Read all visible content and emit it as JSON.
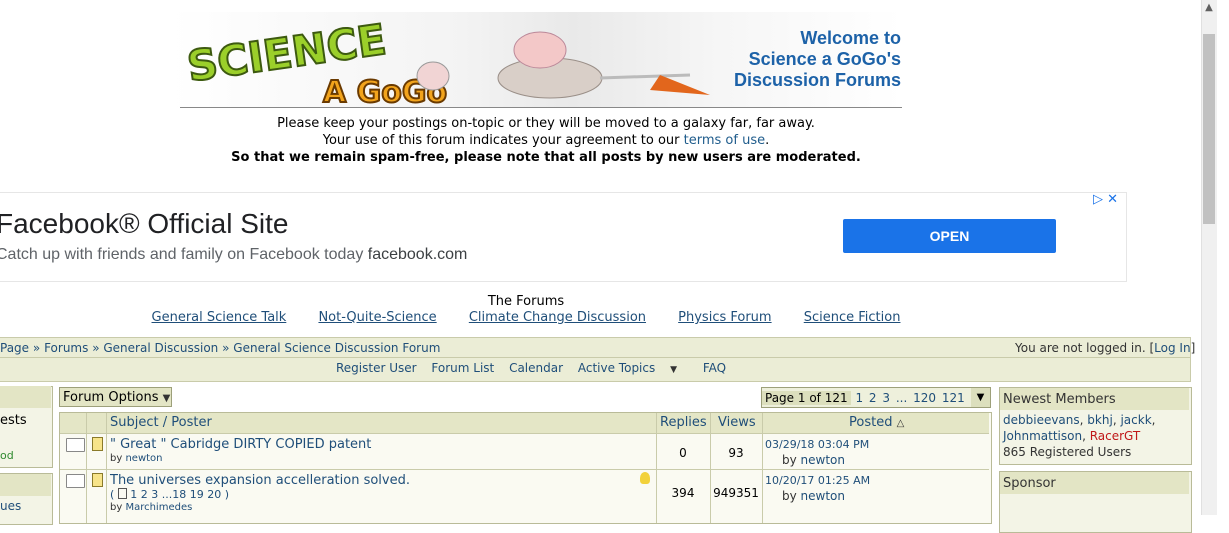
{
  "header": {
    "logo_text_1": "SCIENCE",
    "logo_text_2": "A GoGo",
    "welcome_lines": [
      "Welcome to",
      "Science a GoGo's",
      "Discussion Forums"
    ],
    "notice_line1": "Please keep your postings on-topic or they will be moved to a galaxy far, far away.",
    "notice_line2_pre": "Your use of this forum indicates your agreement to our ",
    "notice_line2_link": "terms of use",
    "notice_line2_post": ".",
    "notice_line3": "So that we remain spam-free, please note that all posts by new users are moderated."
  },
  "ad": {
    "title": "Facebook® Official Site",
    "description": "Catch up with friends and family on Facebook today",
    "domain": "facebook.com",
    "button": "OPEN",
    "choices": "▷ ✕"
  },
  "forums_nav": {
    "title": "The Forums",
    "links": [
      "General Science Talk",
      "Not-Quite-Science",
      "Climate Change Discussion",
      "Physics Forum",
      "Science Fiction"
    ]
  },
  "breadcrumb": {
    "items": [
      "Page",
      "Forums",
      "General Discussion",
      "General Science Discussion Forum"
    ],
    "separator": "»",
    "status_pre": "You are not logged in. [",
    "status_link": "Log In",
    "status_post": "]"
  },
  "subnav": [
    "Register User",
    "Forum List",
    "Calendar",
    "Active Topics",
    "FAQ"
  ],
  "left_sidebar": {
    "box1_text": "ests",
    "box1_text2": "od",
    "box2_text": "ues"
  },
  "forum_options": "Forum Options",
  "pager": {
    "label": "Page 1 of 121",
    "pages": [
      "1",
      "2",
      "3",
      "...",
      "120",
      "121",
      ">"
    ]
  },
  "table": {
    "headers": {
      "subject": "Subject / Poster",
      "replies": "Replies",
      "views": "Views",
      "posted": "Posted",
      "sort_icon": "△"
    },
    "rows": [
      {
        "subject": "\" Great \" Cabridge DIRTY COPIED patent",
        "poster_prefix": "by",
        "poster": "newton",
        "replies": "0",
        "views": "93",
        "posted_date": "03/29/18",
        "posted_time": "03:04 PM",
        "posted_by_prefix": "by",
        "posted_by": "newton"
      },
      {
        "subject": "The universes expansion accelleration solved.",
        "pages_open": "(",
        "pages": "1 2 3 ...18 19 20",
        "pages_close": ")",
        "poster_prefix": "by",
        "poster": "Marchimedes",
        "replies": "394",
        "views": "949351",
        "posted_date": "10/20/17",
        "posted_time": "01:25 AM",
        "posted_by_prefix": "by",
        "posted_by": "newton"
      }
    ]
  },
  "right_sidebar": {
    "newest_title": "Newest Members",
    "members": [
      "debbieevans",
      "bkhj",
      "jackk",
      "Johnmattison"
    ],
    "member_red": "RacerGT",
    "registered": "865 Registered Users",
    "sponsor_title": "Sponsor"
  }
}
